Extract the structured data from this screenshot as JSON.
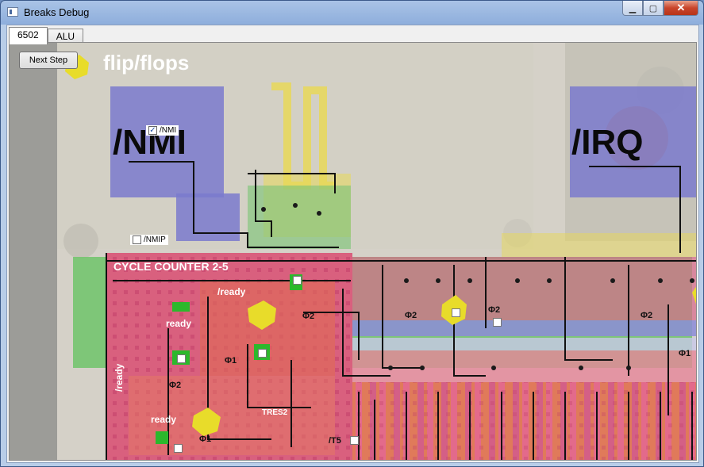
{
  "window": {
    "title": "Breaks Debug",
    "minimize_label": "▁",
    "maximize_label": "▢",
    "close_label": "✕"
  },
  "tabs": [
    {
      "label": "6502",
      "active": true
    },
    {
      "label": "ALU",
      "active": false
    }
  ],
  "toolbar": {
    "next_step_label": "Next Step"
  },
  "overlay": {
    "flipflops": "flip/flops",
    "nmi": "/NMI",
    "irq": "/IRQ",
    "cycle_counter": "CYCLE COUNTER 2-5",
    "ready_1": "/ready",
    "ready_2": "ready",
    "ready_3": "/ready",
    "ready_4": "ready",
    "phi1_a": "Φ1",
    "phi2_a": "Φ2",
    "phi2_b": "Φ2",
    "phi1_b": "Φ1",
    "phi2_c": "Φ2",
    "phi2_d": "Φ2",
    "phi2_e": "Φ2",
    "phi1_c": "Φ1",
    "tres2": "TRES2",
    "t5": "/T5"
  },
  "checkboxes": {
    "nmi": {
      "label": "/NMI",
      "checked": true
    },
    "nmip": {
      "label": "/NMIP",
      "checked": false
    }
  },
  "colors": {
    "pink": "#d9607e",
    "green": "#7fc46a",
    "blue": "#7878c8",
    "yellow": "#e8d44a"
  }
}
